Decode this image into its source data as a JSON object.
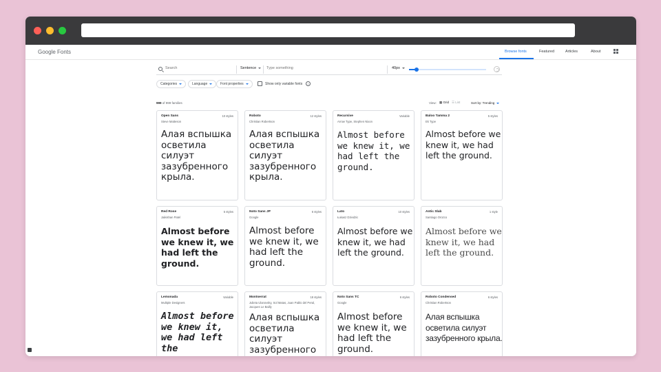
{
  "app": {
    "logo": "Google Fonts"
  },
  "nav": [
    {
      "label": "Browse fonts",
      "active": true
    },
    {
      "label": "Featured",
      "active": false
    },
    {
      "label": "Articles",
      "active": false
    },
    {
      "label": "About",
      "active": false
    }
  ],
  "toolbar": {
    "search_placeholder": "Search",
    "sample_mode": "Sentence",
    "type_placeholder": "Type something",
    "font_size": "40px",
    "size_slider_fraction": 0.1
  },
  "filters": {
    "categories": "Categories",
    "language": "Language",
    "font_properties": "Font properties",
    "variable_only": "Show only variable fonts",
    "info": "i"
  },
  "results": {
    "shown": "999",
    "of_total": "of 999 families",
    "view_label": "View:",
    "grid": "Grid",
    "list": "List",
    "sort": "Sort by: Trending"
  },
  "fonts": [
    {
      "name": "Open Sans",
      "styles": "10 styles",
      "designer": "Steve Matteson",
      "sample": "Алая вспышка осветила силуэт зазубренного крыла."
    },
    {
      "name": "Roboto",
      "styles": "12 styles",
      "designer": "Christian Robertson",
      "sample": "Алая вспышка осветила силуэт зазубренного крыла."
    },
    {
      "name": "Recursive",
      "styles": "Variable",
      "designer": "Arrow Type, Stephen Nixon",
      "sample": "Almost before we knew it, we had left the ground."
    },
    {
      "name": "Baloo Tamma 2",
      "styles": "5 styles",
      "designer": "Ek Type",
      "sample": "Almost before we knew it, we had left the ground."
    },
    {
      "name": "Red Rose",
      "styles": "5 styles",
      "designer": "Jaikishan Patel",
      "sample": "Almost before we knew it, we had left the ground."
    },
    {
      "name": "Noto Sans JP",
      "styles": "6 styles",
      "designer": "Google",
      "sample": "Almost before we knew it, we had left the ground."
    },
    {
      "name": "Lato",
      "styles": "10 styles",
      "designer": "Łukasz Dziedzic",
      "sample": "Almost before we knew it, we had left the ground."
    },
    {
      "name": "Antic Slab",
      "styles": "1 style",
      "designer": "Santiago Orozco",
      "sample": "Almost before we knew it, we had left the ground."
    },
    {
      "name": "Lemonada",
      "styles": "Variable",
      "designer": "Multiple Designers",
      "sample": "Almost before we knew it, we had left the"
    },
    {
      "name": "Montserrat",
      "styles": "18 styles",
      "designer": "Julieta Ulanovsky, Sol Matas, Juan Pablo del Peral, Jacques Le Bailly",
      "sample": "Алая вспышка осветила силуэт зазубренного"
    },
    {
      "name": "Noto Sans TC",
      "styles": "6 styles",
      "designer": "Google",
      "sample": "Almost before we knew it, we had left the ground."
    },
    {
      "name": "Roboto Condensed",
      "styles": "6 styles",
      "designer": "Christian Robertson",
      "sample": "Алая вспышка осветила силуэт зазубренного крыла."
    }
  ]
}
